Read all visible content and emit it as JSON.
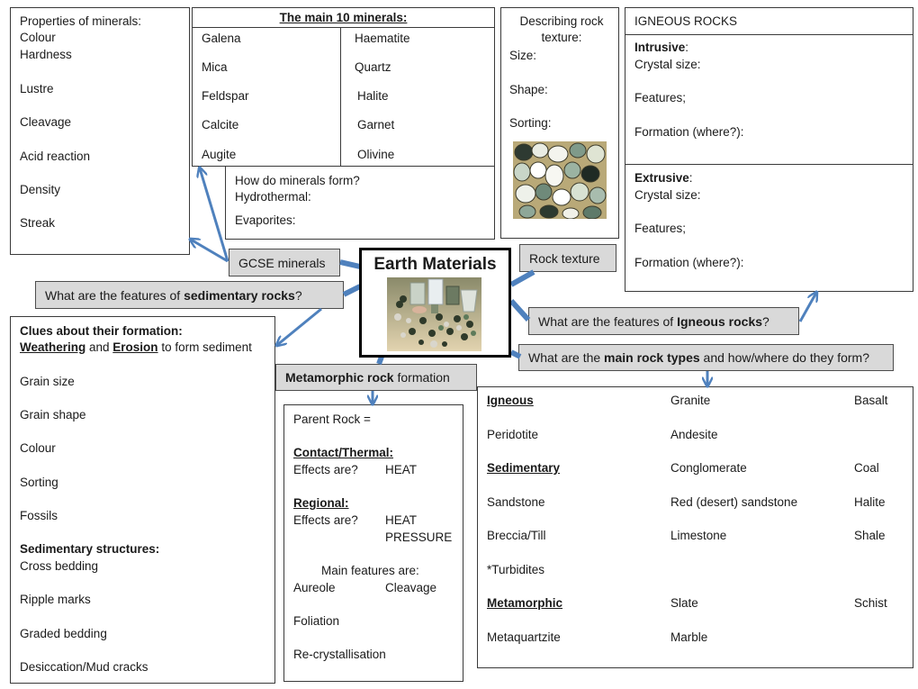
{
  "properties_box": {
    "title": "Properties of minerals:",
    "items": [
      "Colour",
      "Hardness",
      "Lustre",
      "Cleavage",
      "Acid reaction",
      "Density",
      "Streak"
    ]
  },
  "main_minerals": {
    "title": "The main 10 minerals:",
    "left": [
      "Galena",
      "Mica",
      "Feldspar",
      "Calcite",
      "Augite"
    ],
    "right": [
      "Haematite",
      "Quartz",
      "Halite",
      "Garnet",
      "Olivine"
    ]
  },
  "minerals_form": {
    "question": "How do minerals form?",
    "lines": [
      "Hydrothermal:",
      "Evaporites:"
    ]
  },
  "texture_box": {
    "title": "Describing rock texture:",
    "items": [
      "Size:",
      "Shape:",
      "Sorting:"
    ],
    "image": "rock-texture-thin-section-photo"
  },
  "igneous_box": {
    "title": "IGNEOUS ROCKS",
    "intrusive": {
      "heading": "Intrusive",
      "lines": [
        "Crystal size:",
        "Features;",
        "Formation (where?):"
      ]
    },
    "extrusive": {
      "heading": "Extrusive",
      "lines": [
        "Crystal size:",
        "Features;",
        "Formation (where?):"
      ]
    }
  },
  "center": {
    "title": "Earth Materials",
    "image": "rock-samples-photo"
  },
  "labels": {
    "gcse_minerals": "GCSE minerals",
    "rock_texture": "Rock texture",
    "sedimentary_q": {
      "pre": "What are the features of ",
      "bold": "sedimentary rocks",
      "post": "?"
    },
    "igneous_q": {
      "pre": "What are the features of ",
      "bold": "Igneous rocks",
      "post": "?"
    },
    "main_types_q": {
      "pre": "What are the ",
      "bold": "main rock types",
      "post": " and how/where do they form?"
    },
    "metamorphic_q": {
      "bold": "Metamorphic rock",
      "post": " formation"
    }
  },
  "sedimentary_box": {
    "heading": "Clues about their formation:",
    "line2": {
      "u1": "Weathering",
      "mid": " and ",
      "u2": "Erosion",
      "post": " to form sediment"
    },
    "items": [
      "Grain size",
      "Grain shape",
      "Colour",
      "Sorting",
      "Fossils"
    ],
    "structures_heading": "Sedimentary structures:",
    "structures": [
      "Cross bedding",
      "Ripple marks",
      "Graded bedding",
      "Desiccation/Mud cracks"
    ]
  },
  "metamorphic_box": {
    "parent": "Parent Rock =",
    "contact_heading": "Contact/Thermal:",
    "contact_effects": "Effects are?",
    "contact_value": "HEAT",
    "regional_heading": "Regional:",
    "regional_effects": "Effects are?",
    "regional_values": [
      "HEAT",
      "PRESSURE"
    ],
    "features_heading": "Main features are:",
    "features": [
      "Aureole",
      "Cleavage",
      "Foliation",
      "Re-crystallisation"
    ]
  },
  "rock_types": {
    "rows": [
      [
        "Igneous",
        "Granite",
        "Basalt"
      ],
      [
        "Peridotite",
        "Andesite",
        ""
      ],
      [
        "Sedimentary",
        "Conglomerate",
        "Coal"
      ],
      [
        "Sandstone",
        "Red (desert) sandstone",
        "Halite"
      ],
      [
        "Breccia/Till",
        "Limestone",
        "Shale"
      ],
      [
        "*Turbidites",
        "",
        ""
      ],
      [
        "Metamorphic",
        "Slate",
        "Schist"
      ],
      [
        "Metaquartzite",
        "Marble",
        ""
      ]
    ],
    "heading_rows": [
      0,
      2,
      6
    ]
  },
  "colors": {
    "arrow": "#4f81bd",
    "label_bg": "#d9d9d9"
  }
}
